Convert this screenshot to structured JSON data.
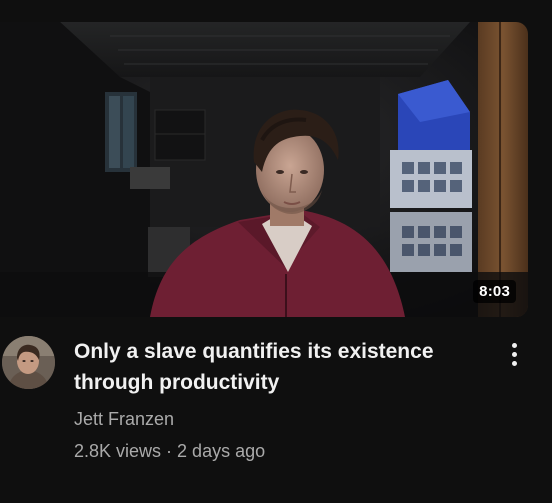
{
  "video": {
    "title": "Only a slave quantifies its existence through productivity",
    "channel": "Jett Franzen",
    "views": "2.8K views",
    "separator": "·",
    "age": "2 days ago",
    "duration": "8:03"
  },
  "icons": {
    "menu": "more-vert-icon",
    "avatar": "channel-avatar"
  },
  "colors": {
    "background": "#0f0f0f",
    "title": "#f1f1f1",
    "secondary_text": "#aaaaaa",
    "shirt": "#6e1f33"
  }
}
